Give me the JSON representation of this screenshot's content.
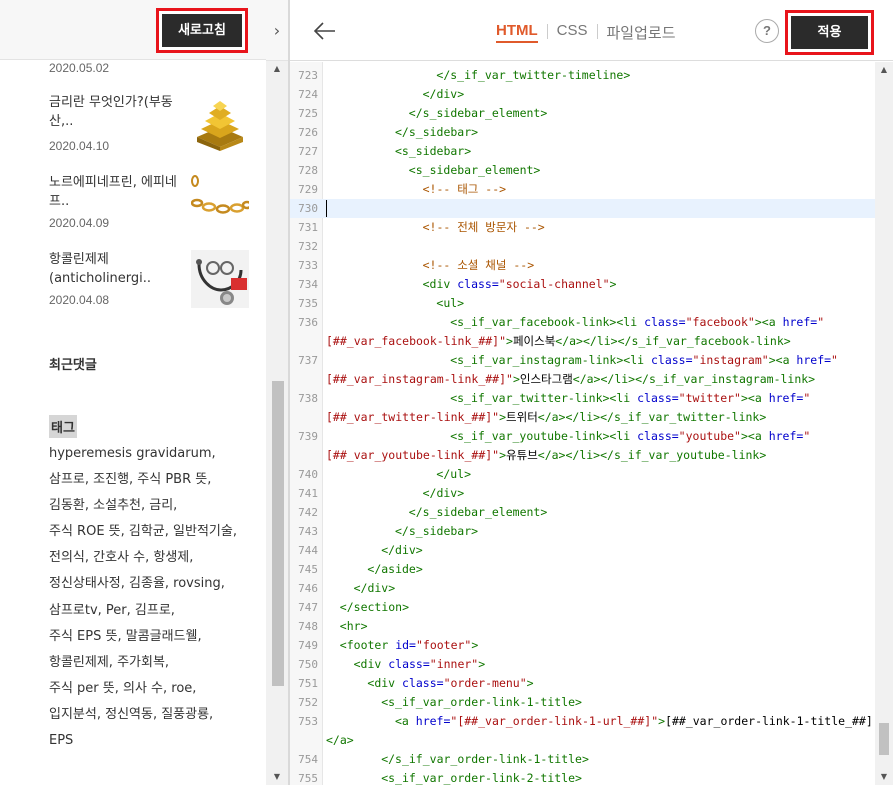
{
  "preview": {
    "refresh_label": "새로고침",
    "posts": [
      {
        "title": "",
        "date": "2020.05.02",
        "thumb": "gold-coins-thumbnail"
      },
      {
        "title": "금리란 무엇인가?(부동산,..",
        "date": "2020.04.10",
        "thumb": "gold-bars-thumbnail"
      },
      {
        "title": "노르에피네프린, 에피네프..",
        "date": "2020.04.09",
        "thumb": "gold-chain-thumbnail"
      },
      {
        "title": "항콜린제제(anticholinergi..",
        "date": "2020.04.08",
        "thumb": "stethoscope-thumbnail"
      }
    ],
    "recent_comments_heading": "최근댓글",
    "tags_heading": "태그",
    "tags": [
      "hyperemesis gravidarum",
      "삼프로",
      "조진행",
      "주식 PBR 뜻",
      "김동환",
      "소설추천",
      "금리",
      "주식 ROE 뜻",
      "김학균",
      "일반적기술",
      "전의식",
      "간호사 수",
      "항생제",
      "정신상태사정",
      "김종율",
      "rovsing",
      "삼프로tv",
      "Per",
      "김프로",
      "주식 EPS 뜻",
      "말콤글래드웰",
      "항콜린제제",
      "주가회복",
      "주식 per 뜻",
      "의사 수",
      "roe",
      "입지분석",
      "정신역동",
      "질풍광룡",
      "EPS"
    ],
    "tag_lines": [
      "hyperemesis gravidarum,",
      "삼프로, 조진행, 주식 PBR 뜻,",
      "김동환, 소설추천, 금리,",
      "주식 ROE 뜻, 김학균, 일반적기술,",
      "전의식, 간호사 수, 항생제,",
      "정신상태사정, 김종율, rovsing,",
      "삼프로tv, Per, 김프로,",
      "주식 EPS 뜻, 말콤글래드웰,",
      "항콜린제제, 주가회복,",
      "주식 per 뜻, 의사 수, roe,",
      "입지분석, 정신역동, 질풍광룡,",
      "EPS"
    ]
  },
  "editor": {
    "tabs": [
      {
        "label": "HTML",
        "active": true
      },
      {
        "label": "CSS",
        "active": false
      },
      {
        "label": "파일업로드",
        "active": false
      }
    ],
    "help_label": "?",
    "apply_label": "적용",
    "active_line": "730",
    "lines": [
      {
        "n": "723",
        "indent": 16,
        "tokens": [
          [
            "t",
            "</s_if_var_twitter-timeline>"
          ]
        ]
      },
      {
        "n": "724",
        "indent": 14,
        "tokens": [
          [
            "t",
            "</div>"
          ]
        ]
      },
      {
        "n": "725",
        "indent": 12,
        "tokens": [
          [
            "t",
            "</s_sidebar_element>"
          ]
        ]
      },
      {
        "n": "726",
        "indent": 10,
        "tokens": [
          [
            "t",
            "</s_sidebar>"
          ]
        ]
      },
      {
        "n": "727",
        "indent": 10,
        "tokens": [
          [
            "t",
            "<s_sidebar>"
          ]
        ]
      },
      {
        "n": "728",
        "indent": 12,
        "tokens": [
          [
            "t",
            "<s_sidebar_element>"
          ]
        ]
      },
      {
        "n": "729",
        "indent": 14,
        "tokens": [
          [
            "c",
            "<!-- 태그 -->"
          ]
        ]
      },
      {
        "n": "730",
        "indent": 0,
        "tokens": []
      },
      {
        "n": "731",
        "indent": 14,
        "tokens": [
          [
            "c",
            "<!-- 전체 방문자 -->"
          ]
        ]
      },
      {
        "n": "732",
        "indent": 0,
        "tokens": []
      },
      {
        "n": "733",
        "indent": 14,
        "tokens": [
          [
            "c",
            "<!-- 소셜 채널 -->"
          ]
        ]
      },
      {
        "n": "734",
        "indent": 14,
        "tokens": [
          [
            "t",
            "<div "
          ],
          [
            "a",
            "class="
          ],
          [
            "s",
            "\"social-channel\""
          ],
          [
            "t",
            ">"
          ]
        ]
      },
      {
        "n": "735",
        "indent": 16,
        "tokens": [
          [
            "t",
            "<ul>"
          ]
        ]
      },
      {
        "n": "736",
        "indent": 18,
        "tokens": [
          [
            "t",
            "<s_if_var_facebook-link><li "
          ],
          [
            "a",
            "class="
          ],
          [
            "s",
            "\"facebook\""
          ],
          [
            "t",
            ">"
          ],
          [
            "t",
            "<a "
          ],
          [
            "a",
            "href="
          ],
          [
            "s",
            "\""
          ]
        ]
      },
      {
        "n": "",
        "indent": 0,
        "tokens": [
          [
            "s",
            "[##_var_facebook-link_##]\""
          ],
          [
            "t",
            ">"
          ],
          [
            "x",
            "페이스북"
          ],
          [
            "t",
            "</a></li></s_if_var_facebook-link>"
          ]
        ]
      },
      {
        "n": "737",
        "indent": 18,
        "tokens": [
          [
            "t",
            "<s_if_var_instagram-link><li "
          ],
          [
            "a",
            "class="
          ],
          [
            "s",
            "\"instagram\""
          ],
          [
            "t",
            ">"
          ],
          [
            "t",
            "<a "
          ],
          [
            "a",
            "href="
          ],
          [
            "s",
            "\""
          ]
        ]
      },
      {
        "n": "",
        "indent": 0,
        "tokens": [
          [
            "s",
            "[##_var_instagram-link_##]\""
          ],
          [
            "t",
            ">"
          ],
          [
            "x",
            "인스타그램"
          ],
          [
            "t",
            "</a></li></s_if_var_instagram-link>"
          ]
        ]
      },
      {
        "n": "738",
        "indent": 18,
        "tokens": [
          [
            "t",
            "<s_if_var_twitter-link><li "
          ],
          [
            "a",
            "class="
          ],
          [
            "s",
            "\"twitter\""
          ],
          [
            "t",
            ">"
          ],
          [
            "t",
            "<a "
          ],
          [
            "a",
            "href="
          ],
          [
            "s",
            "\""
          ]
        ]
      },
      {
        "n": "",
        "indent": 0,
        "tokens": [
          [
            "s",
            "[##_var_twitter-link_##]\""
          ],
          [
            "t",
            ">"
          ],
          [
            "x",
            "트위터"
          ],
          [
            "t",
            "</a></li></s_if_var_twitter-link>"
          ]
        ]
      },
      {
        "n": "739",
        "indent": 18,
        "tokens": [
          [
            "t",
            "<s_if_var_youtube-link><li "
          ],
          [
            "a",
            "class="
          ],
          [
            "s",
            "\"youtube\""
          ],
          [
            "t",
            ">"
          ],
          [
            "t",
            "<a "
          ],
          [
            "a",
            "href="
          ],
          [
            "s",
            "\""
          ]
        ]
      },
      {
        "n": "",
        "indent": 0,
        "tokens": [
          [
            "s",
            "[##_var_youtube-link_##]\""
          ],
          [
            "t",
            ">"
          ],
          [
            "x",
            "유튜브"
          ],
          [
            "t",
            "</a></li></s_if_var_youtube-link>"
          ]
        ]
      },
      {
        "n": "740",
        "indent": 16,
        "tokens": [
          [
            "t",
            "</ul>"
          ]
        ]
      },
      {
        "n": "741",
        "indent": 14,
        "tokens": [
          [
            "t",
            "</div>"
          ]
        ]
      },
      {
        "n": "742",
        "indent": 12,
        "tokens": [
          [
            "t",
            "</s_sidebar_element>"
          ]
        ]
      },
      {
        "n": "743",
        "indent": 10,
        "tokens": [
          [
            "t",
            "</s_sidebar>"
          ]
        ]
      },
      {
        "n": "744",
        "indent": 8,
        "tokens": [
          [
            "t",
            "</div>"
          ]
        ]
      },
      {
        "n": "745",
        "indent": 6,
        "tokens": [
          [
            "t",
            "</aside>"
          ]
        ]
      },
      {
        "n": "746",
        "indent": 4,
        "tokens": [
          [
            "t",
            "</div>"
          ]
        ]
      },
      {
        "n": "747",
        "indent": 2,
        "tokens": [
          [
            "t",
            "</section>"
          ]
        ]
      },
      {
        "n": "748",
        "indent": 2,
        "tokens": [
          [
            "t",
            "<hr>"
          ]
        ]
      },
      {
        "n": "749",
        "indent": 2,
        "tokens": [
          [
            "t",
            "<footer "
          ],
          [
            "a",
            "id="
          ],
          [
            "s",
            "\"footer\""
          ],
          [
            "t",
            ">"
          ]
        ]
      },
      {
        "n": "750",
        "indent": 4,
        "tokens": [
          [
            "t",
            "<div "
          ],
          [
            "a",
            "class="
          ],
          [
            "s",
            "\"inner\""
          ],
          [
            "t",
            ">"
          ]
        ]
      },
      {
        "n": "751",
        "indent": 6,
        "tokens": [
          [
            "t",
            "<div "
          ],
          [
            "a",
            "class="
          ],
          [
            "s",
            "\"order-menu\""
          ],
          [
            "t",
            ">"
          ]
        ]
      },
      {
        "n": "752",
        "indent": 8,
        "tokens": [
          [
            "t",
            "<s_if_var_order-link-1-title>"
          ]
        ]
      },
      {
        "n": "753",
        "indent": 10,
        "tokens": [
          [
            "t",
            "<a "
          ],
          [
            "a",
            "href="
          ],
          [
            "s",
            "\"[##_var_order-link-1-url_##]\""
          ],
          [
            "t",
            ">"
          ],
          [
            "x",
            "[##_var_order-link-1-title_##]"
          ]
        ]
      },
      {
        "n": "",
        "indent": 0,
        "tokens": [
          [
            "t",
            "</a>"
          ]
        ]
      },
      {
        "n": "754",
        "indent": 8,
        "tokens": [
          [
            "t",
            "</s_if_var_order-link-1-title>"
          ]
        ]
      },
      {
        "n": "755",
        "indent": 8,
        "tokens": [
          [
            "t",
            "<s_if_var_order-link-2-title>"
          ]
        ]
      }
    ]
  }
}
